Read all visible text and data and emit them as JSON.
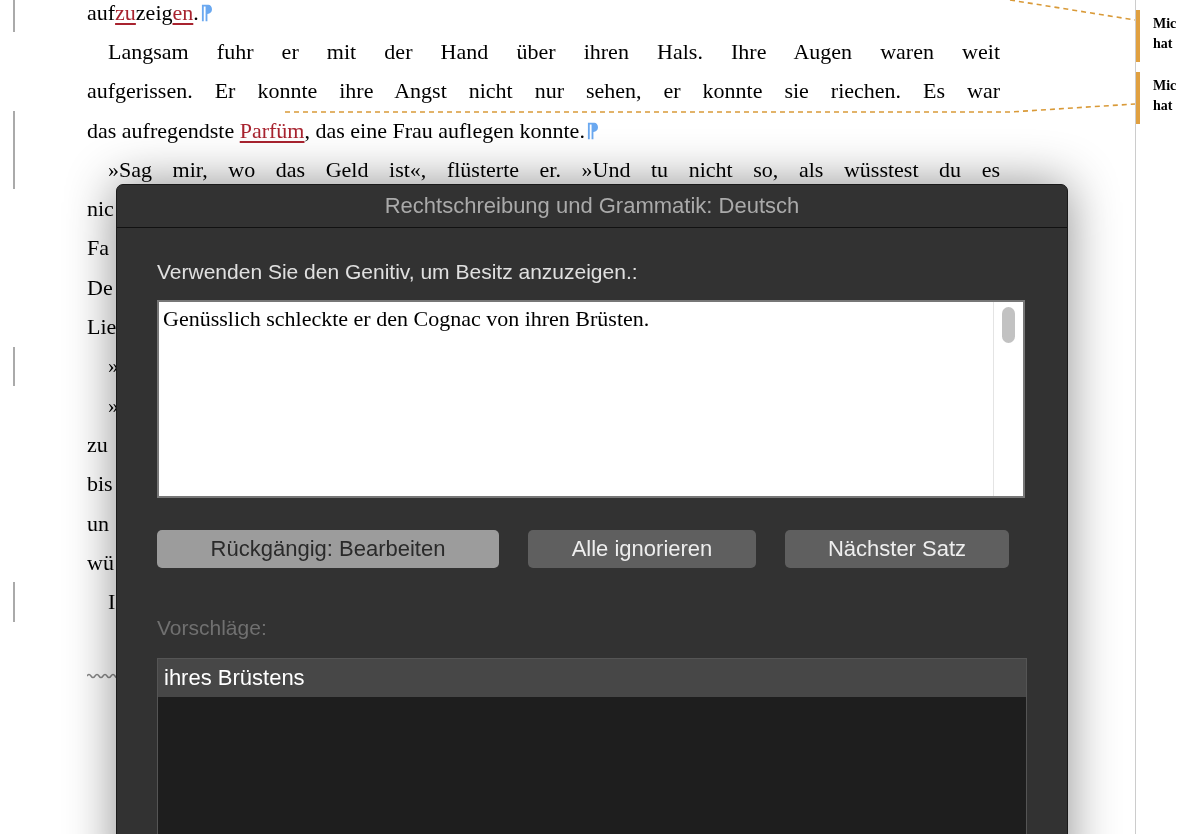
{
  "document": {
    "lines": [
      {
        "kind": "line",
        "indent": false,
        "changed": true,
        "pilcrow": true,
        "segments": [
          {
            "text": "auf",
            "error": false
          },
          {
            "text": "zu",
            "error": true
          },
          {
            "text": "zeig",
            "error": false
          },
          {
            "text": "en",
            "error": true
          },
          {
            "text": ".",
            "error": false
          }
        ]
      },
      {
        "kind": "line",
        "indent": true,
        "segments": [
          {
            "text": "Langsam fuhr er mit der Hand über ihren Hals. Ihre Augen waren weit",
            "error": false
          }
        ]
      },
      {
        "kind": "line",
        "indent": false,
        "segments": [
          {
            "text": "aufgerissen. Er konnte ihre Angst nicht nur sehen, er konnte sie riechen. Es war",
            "error": false
          }
        ]
      },
      {
        "kind": "line",
        "indent": false,
        "changed": true,
        "pilcrow": true,
        "segments": [
          {
            "text": "das aufregendste ",
            "error": false
          },
          {
            "text": "Parfüm",
            "error": true
          },
          {
            "text": ", das eine Frau auflegen konnte.",
            "error": false
          }
        ]
      },
      {
        "kind": "line",
        "indent": true,
        "changed": true,
        "segments": [
          {
            "text": "»Sag mir, wo das Geld ist«, flüsterte er. »Und tu nicht so, als wüsstest du es",
            "error": false
          }
        ]
      },
      {
        "kind": "cut",
        "indent": false,
        "segments": [
          {
            "text": "nic",
            "error": false
          }
        ]
      },
      {
        "kind": "cut",
        "indent": false,
        "segments": [
          {
            "text": "Fa",
            "error": false
          }
        ]
      },
      {
        "kind": "cut",
        "indent": false,
        "segments": [
          {
            "text": "De",
            "error": false
          }
        ]
      },
      {
        "kind": "cut",
        "indent": false,
        "segments": [
          {
            "text": "Lie",
            "error": false
          }
        ]
      },
      {
        "kind": "cut",
        "indent": true,
        "changed": true,
        "segments": [
          {
            "text": "»",
            "error": false
          }
        ]
      },
      {
        "kind": "cut",
        "indent": true,
        "segments": [
          {
            "text": "»",
            "error": false
          }
        ]
      },
      {
        "kind": "cut",
        "indent": false,
        "segments": [
          {
            "text": "zu",
            "error": false
          }
        ]
      },
      {
        "kind": "cut",
        "indent": false,
        "segments": [
          {
            "text": "bis",
            "error": false
          }
        ]
      },
      {
        "kind": "cut",
        "indent": false,
        "segments": [
          {
            "text": "un",
            "error": false
          }
        ]
      },
      {
        "kind": "cut",
        "indent": false,
        "segments": [
          {
            "text": "wü",
            "error": false
          }
        ]
      },
      {
        "kind": "cut",
        "indent": true,
        "changed": true,
        "segments": [
          {
            "text": "I",
            "error": false
          }
        ]
      }
    ]
  },
  "comments": [
    {
      "lines": [
        "Mic",
        "hat"
      ]
    },
    {
      "lines": [
        "Mic",
        "hat"
      ]
    }
  ],
  "dialog": {
    "title": "Rechtschreibung und Grammatik: Deutsch",
    "message": "Verwenden Sie den Genitiv, um Besitz anzuzeigen.:",
    "sentence": "Genüsslich schleckte er den Cognac von ihren Brüsten.",
    "buttons": [
      {
        "label": "Rückgängig: Bearbeiten",
        "highlighted": true
      },
      {
        "label": "Alle ignorieren",
        "highlighted": false
      },
      {
        "label": "Nächster Satz",
        "highlighted": false
      }
    ],
    "suggestions_label": "Vorschläge:",
    "suggestions": [
      {
        "text": "ihres Brüstens",
        "selected": true
      }
    ]
  }
}
